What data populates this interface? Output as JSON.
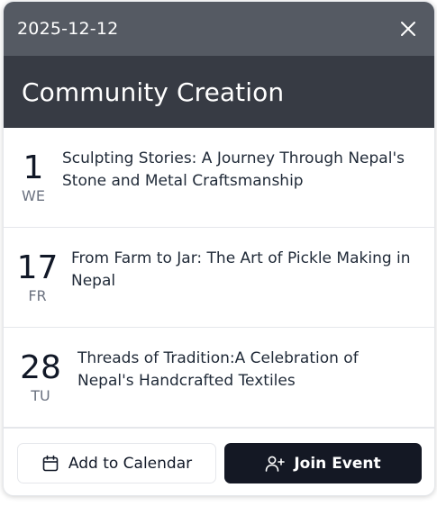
{
  "header": {
    "date": "2025-12-12",
    "title": "Community Creation"
  },
  "events": [
    {
      "day": "1",
      "weekday": "WE",
      "title": "Sculpting Stories: A Journey Through Nepal's Stone and Metal Craftsmanship"
    },
    {
      "day": "17",
      "weekday": "FR",
      "title": "From Farm to Jar: The Art of Pickle Making in Nepal"
    },
    {
      "day": "28",
      "weekday": "TU",
      "title": "Threads of Tradition:A Celebration of Nepal's Handcrafted Textiles"
    }
  ],
  "footer": {
    "add_to_calendar": "Add to Calendar",
    "join_event": "Join Event",
    "add_icon": "calendar-icon",
    "join_icon": "user-plus-icon"
  },
  "colors": {
    "topbar": "#555a63",
    "titlebar": "#373b44",
    "primary_button": "#141824"
  }
}
